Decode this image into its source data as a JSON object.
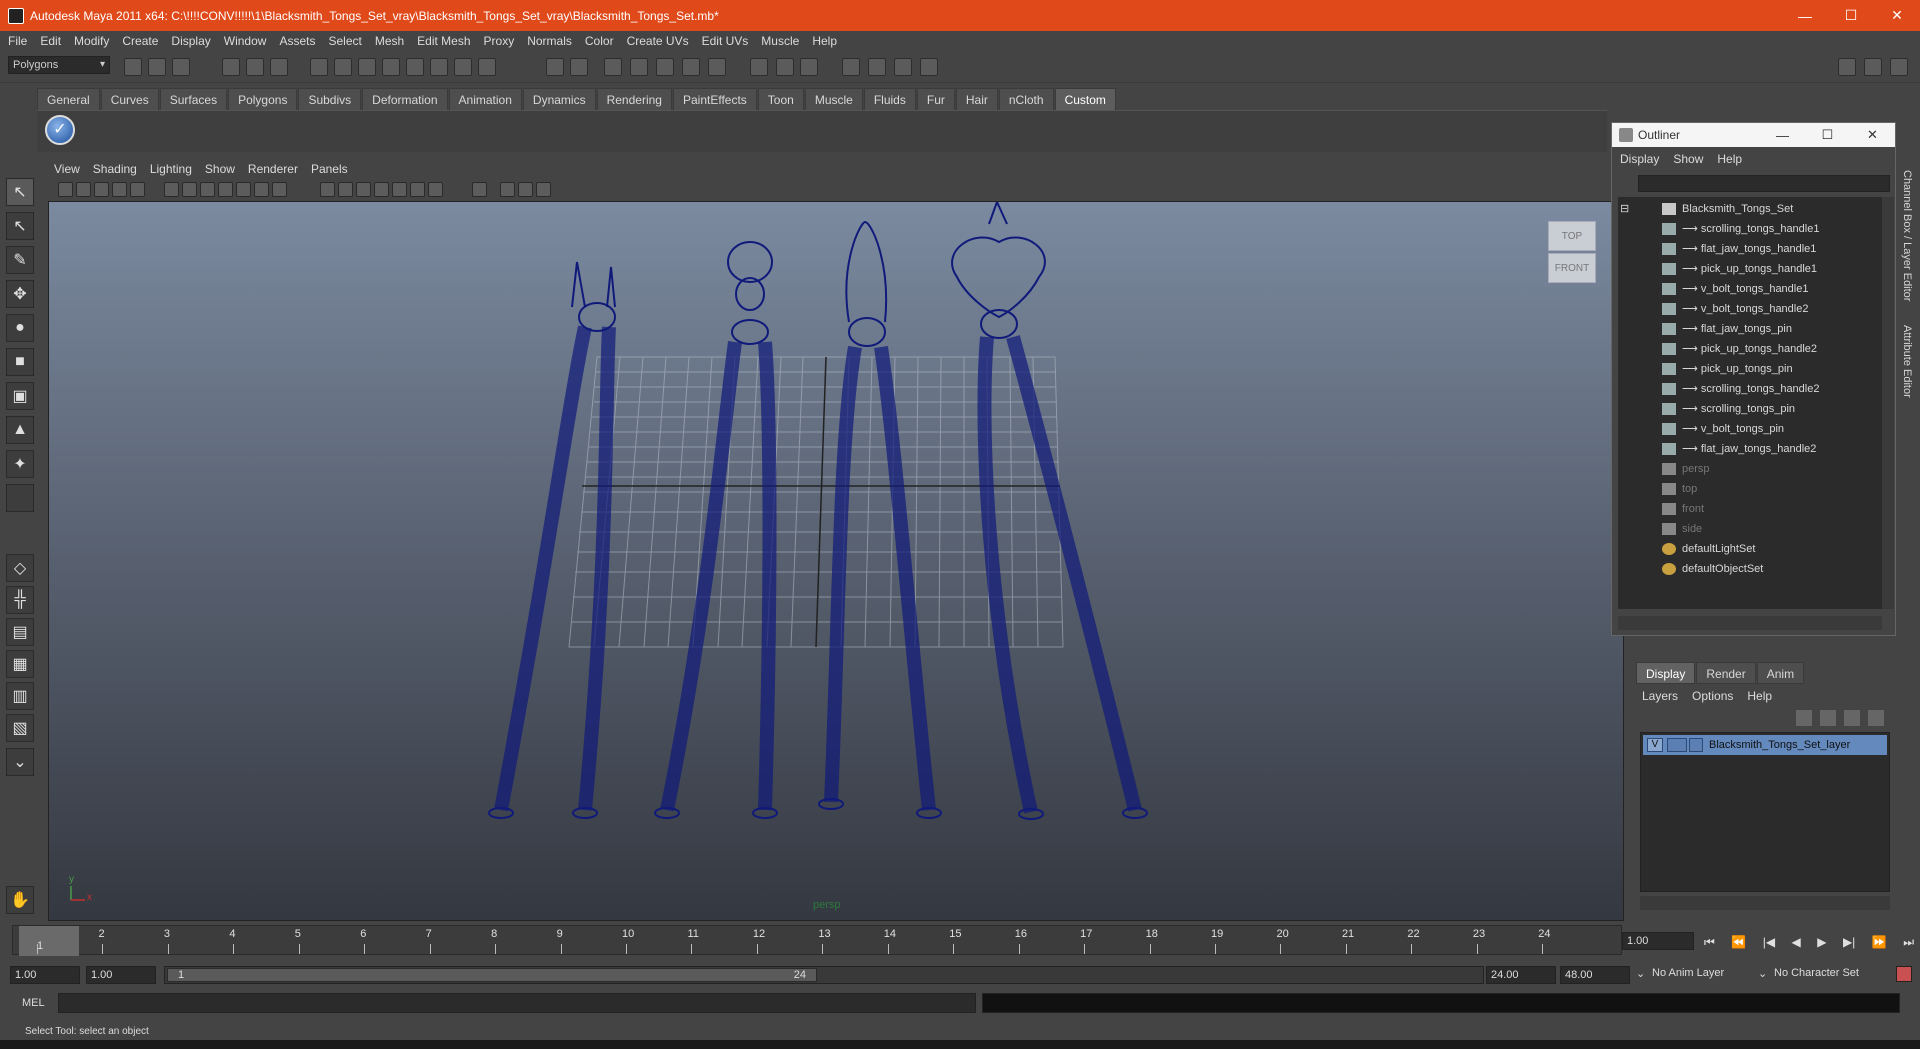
{
  "window": {
    "title": "Autodesk Maya 2011 x64: C:\\!!!!CONV!!!!!\\1\\Blacksmith_Tongs_Set_vray\\Blacksmith_Tongs_Set_vray\\Blacksmith_Tongs_Set.mb*",
    "min": "—",
    "max": "☐",
    "close": "✕"
  },
  "menubar": [
    "File",
    "Edit",
    "Modify",
    "Create",
    "Display",
    "Window",
    "Assets",
    "Select",
    "Mesh",
    "Edit Mesh",
    "Proxy",
    "Normals",
    "Color",
    "Create UVs",
    "Edit UVs",
    "Muscle",
    "Help"
  ],
  "statusline": {
    "mode": "Polygons"
  },
  "shelf": {
    "tabs": [
      "General",
      "Curves",
      "Surfaces",
      "Polygons",
      "Subdivs",
      "Deformation",
      "Animation",
      "Dynamics",
      "Rendering",
      "PaintEffects",
      "Toon",
      "Muscle",
      "Fluids",
      "Fur",
      "Hair",
      "nCloth",
      "Custom"
    ],
    "active": "Custom",
    "check_icon": "✓"
  },
  "panel": {
    "menu": [
      "View",
      "Shading",
      "Lighting",
      "Show",
      "Renderer",
      "Panels"
    ],
    "camera_label": "persp",
    "viewcube": {
      "top": "TOP",
      "front": "FRONT"
    },
    "axis": {
      "y": "y",
      "x": "x"
    }
  },
  "outliner": {
    "title": "Outliner",
    "min": "—",
    "max": "☐",
    "close": "✕",
    "menu": [
      "Display",
      "Show",
      "Help"
    ],
    "root": "Blacksmith_Tongs_Set",
    "children": [
      "scrolling_tongs_handle1",
      "flat_jaw_tongs_handle1",
      "pick_up_tongs_handle1",
      "v_bolt_tongs_handle1",
      "v_bolt_tongs_handle2",
      "flat_jaw_tongs_pin",
      "pick_up_tongs_handle2",
      "pick_up_tongs_pin",
      "scrolling_tongs_handle2",
      "scrolling_tongs_pin",
      "v_bolt_tongs_pin",
      "flat_jaw_tongs_handle2"
    ],
    "cameras": [
      "persp",
      "top",
      "front",
      "side"
    ],
    "sets": [
      "defaultLightSet",
      "defaultObjectSet"
    ]
  },
  "layer_editor": {
    "tabs": [
      "Display",
      "Render",
      "Anim"
    ],
    "active": "Display",
    "menu": [
      "Layers",
      "Options",
      "Help"
    ],
    "layer": {
      "visible": "V",
      "name": "Blacksmith_Tongs_Set_layer"
    }
  },
  "dock": {
    "channel_box": "Channel Box / Layer Editor",
    "attribute_editor": "Attribute Editor"
  },
  "timeline": {
    "frames": [
      "1",
      "2",
      "3",
      "4",
      "5",
      "6",
      "7",
      "8",
      "9",
      "10",
      "11",
      "12",
      "13",
      "14",
      "15",
      "16",
      "17",
      "18",
      "19",
      "20",
      "21",
      "22",
      "23",
      "24"
    ],
    "current": "1",
    "current_field": "1.00",
    "playback": [
      "⏮",
      "⏪",
      "|◀",
      "◀",
      "▶",
      "▶|",
      "⏩",
      "⏭"
    ]
  },
  "range": {
    "start_outer": "1.00",
    "start_inner": "1.00",
    "slider_start": "1",
    "slider_end": "24",
    "end_inner": "24.00",
    "end_outer": "48.00",
    "anim_layer": "No Anim Layer",
    "char_set": "No Character Set"
  },
  "commandline": {
    "label": "MEL"
  },
  "helpline": {
    "text": "Select Tool: select an object"
  }
}
